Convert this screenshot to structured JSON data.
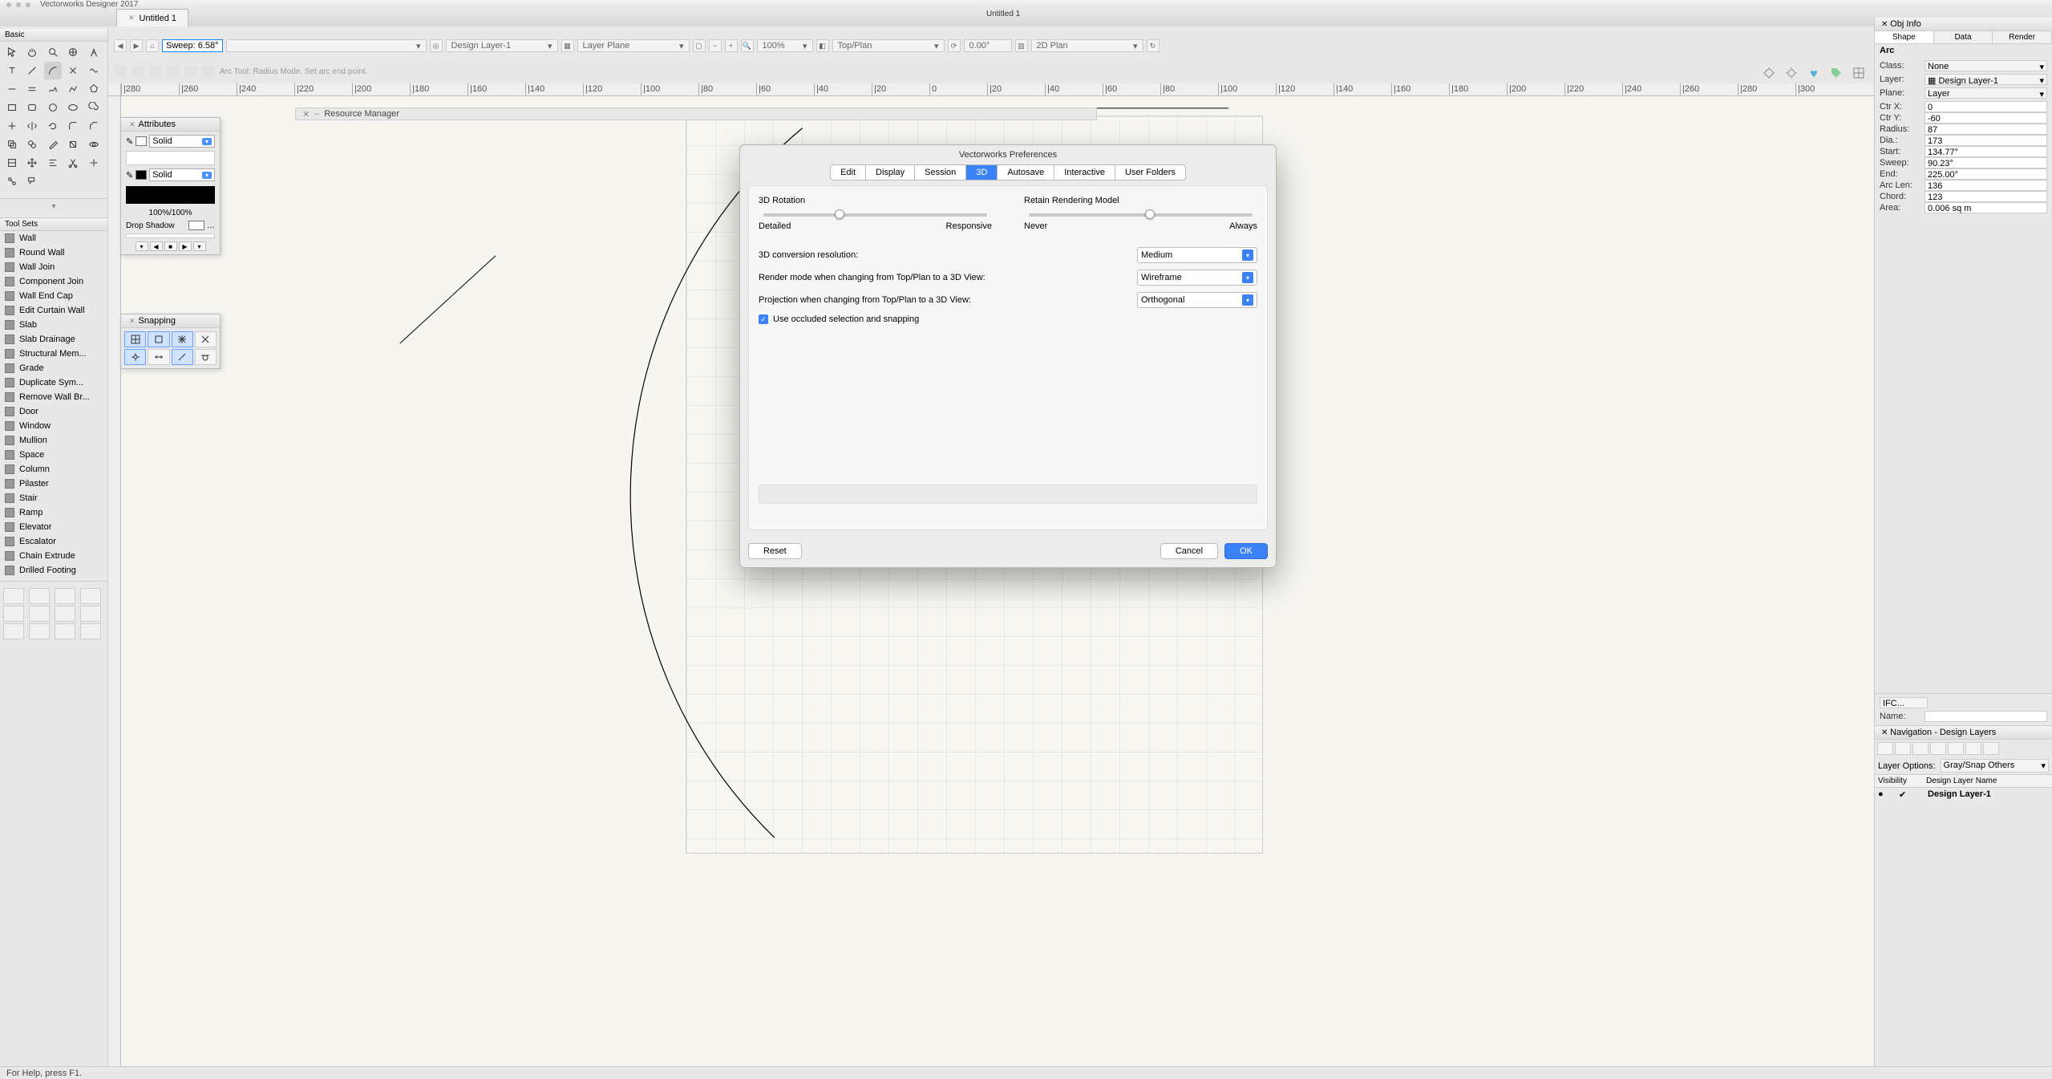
{
  "mac_title": "Vectorworks Designer 2017",
  "doc_title": "Untitled 1",
  "window_center_title": "Untitled 1",
  "toolbar": {
    "param_label": "Sweep:",
    "param_value": "6.58°",
    "layer_dropdown": "Design Layer-1",
    "plane_dropdown": "Layer Plane",
    "zoom_value": "100%",
    "view_dropdown": "Top/Plan",
    "rot_value": "0.00°",
    "plan_dropdown": "2D Plan"
  },
  "mode_hint": "Arc Tool: Radius Mode. Set arc end point.",
  "status_text": "For Help, press F1.",
  "left_header": "Basic",
  "toolsets_header": "Tool Sets",
  "toolsets": [
    "Wall",
    "Round Wall",
    "Wall Join",
    "Component Join",
    "Wall End Cap",
    "Edit Curtain Wall",
    "Slab",
    "Slab Drainage",
    "Structural Mem...",
    "Grade",
    "Duplicate Sym...",
    "Remove Wall Br...",
    "Door",
    "Window",
    "Mullion",
    "Space",
    "Column",
    "Pilaster",
    "Stair",
    "Ramp",
    "Elevator",
    "Escalator",
    "Chain Extrude",
    "Drilled Footing"
  ],
  "attributes": {
    "title": "Attributes",
    "fill_mode": "Solid",
    "stroke_mode": "Solid",
    "opacity": "100%/100%",
    "shadow_label": "Drop Shadow"
  },
  "snapping": {
    "title": "Snapping"
  },
  "resource_mgr": "Resource Manager",
  "ruler_ticks": [
    "|280",
    "|260",
    "|240",
    "|220",
    "|200",
    "|180",
    "|160",
    "|140",
    "|120",
    "|100",
    "|80",
    "|60",
    "|40",
    "|20",
    "0",
    "|20",
    "|40",
    "|60",
    "|80",
    "|100",
    "|120",
    "|140",
    "|160",
    "|180",
    "|200",
    "|220",
    "|240",
    "|260",
    "|280",
    "|300"
  ],
  "obj_info": {
    "title": "Obj Info",
    "tabs": [
      "Shape",
      "Data",
      "Render"
    ],
    "obj_type": "Arc",
    "class_label": "Class:",
    "class_value": "None",
    "layer_label": "Layer:",
    "layer_value": "Design Layer-1",
    "plane_label": "Plane:",
    "plane_value": "Layer",
    "rows": [
      {
        "label": "Ctr X:",
        "value": "0"
      },
      {
        "label": "Ctr Y:",
        "value": "-60"
      },
      {
        "label": "Radius:",
        "value": "87"
      },
      {
        "label": "Dia.:",
        "value": "173"
      },
      {
        "label": "Start:",
        "value": "134.77°"
      },
      {
        "label": "Sweep:",
        "value": "90.23°"
      },
      {
        "label": "End:",
        "value": "225.00°"
      },
      {
        "label": "Arc Len:",
        "value": "136"
      },
      {
        "label": "Chord:",
        "value": "123"
      },
      {
        "label": "Area:",
        "value": "0.006 sq m"
      }
    ],
    "ifc_label": "IFC...",
    "name_label": "Name:"
  },
  "nav": {
    "title": "Navigation - Design Layers",
    "options_label": "Layer Options:",
    "options_value": "Gray/Snap Others",
    "col_vis": "Visibility",
    "col_name": "Design Layer Name",
    "row_name": "Design Layer-1"
  },
  "modal": {
    "title": "Vectorworks Preferences",
    "tabs": [
      "Edit",
      "Display",
      "Session",
      "3D",
      "Autosave",
      "Interactive",
      "User Folders"
    ],
    "active_tab": 3,
    "rot_label": "3D Rotation",
    "rot_left": "Detailed",
    "rot_right": "Responsive",
    "ret_label": "Retain Rendering Model",
    "ret_left": "Never",
    "ret_right": "Always",
    "rows": [
      {
        "label": "3D conversion resolution:",
        "value": "Medium"
      },
      {
        "label": "Render mode when changing from Top/Plan to a 3D View:",
        "value": "Wireframe"
      },
      {
        "label": "Projection when changing from Top/Plan to a 3D View:",
        "value": "Orthogonal"
      }
    ],
    "checkbox": "Use occluded selection and snapping",
    "reset": "Reset",
    "cancel": "Cancel",
    "ok": "OK"
  }
}
